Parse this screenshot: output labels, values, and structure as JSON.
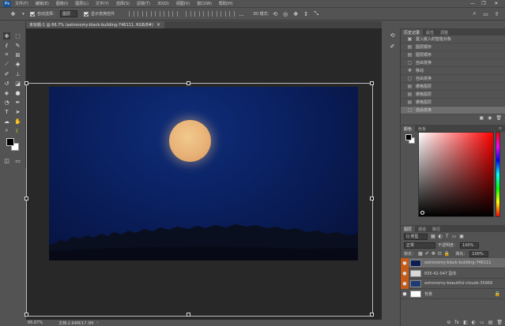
{
  "app": {
    "logo": "Ps"
  },
  "menubar": {
    "items": [
      "文件(F)",
      "编辑(E)",
      "图像(I)",
      "图层(L)",
      "文字(Y)",
      "选择(S)",
      "滤镜(T)",
      "3D(D)",
      "视图(V)",
      "窗口(W)",
      "帮助(H)"
    ]
  },
  "window_controls": {
    "minimize": "—",
    "maximize": "❐",
    "close": "✕"
  },
  "options": {
    "auto_select_label": "自动选择：",
    "auto_select_value": "图层",
    "show_transform_label": "显示变换控件",
    "mode3d_label": "3D 模式："
  },
  "document": {
    "tab_title": "未标题-1 @ 66.7% (astronomy-black-building-746111, RGB/8#)",
    "tab_close": "×"
  },
  "status": {
    "zoom": "66.67%",
    "doc_info": "文档:2.64M/17.3M",
    "arrow": "›"
  },
  "history": {
    "tabs": [
      "历史记录",
      "属性",
      "调整"
    ],
    "items": [
      {
        "label": "置入嵌入的智能对象",
        "icon": "▣"
      },
      {
        "label": "图层顺序",
        "icon": "▤"
      },
      {
        "label": "图层顺序",
        "icon": "▤"
      },
      {
        "label": "自由变换",
        "icon": "▢"
      },
      {
        "label": "移动",
        "icon": "✥"
      },
      {
        "label": "自由变换",
        "icon": "▢"
      },
      {
        "label": "栅格图层",
        "icon": "▤"
      },
      {
        "label": "栅格图层",
        "icon": "▤"
      },
      {
        "label": "栅格图层",
        "icon": "▤"
      },
      {
        "label": "自由变换",
        "icon": "▢"
      }
    ],
    "selected_index": 9
  },
  "color": {
    "tabs": [
      "颜色",
      "色板"
    ],
    "menu": "≡"
  },
  "layers": {
    "tabs": [
      "图层",
      "通道",
      "路径"
    ],
    "filter_label": "Q 类型",
    "blend_mode": "正常",
    "opacity_label": "不透明度：",
    "opacity_value": "100%",
    "lock_label": "锁定：",
    "fill_label": "填充：",
    "fill_value": "100%",
    "items": [
      {
        "name": "astronomy-black-building-746111",
        "eye": "●",
        "thumb": "#0b1d52",
        "highlight": true,
        "selected": true
      },
      {
        "name": "835-42-047 副本",
        "eye": "●",
        "thumb": "#d8d8d8",
        "highlight": true,
        "selected": false
      },
      {
        "name": "astronomy-beautiful-clouds-35969",
        "eye": "●",
        "thumb": "#1d3a73",
        "highlight": true,
        "selected": false
      },
      {
        "name": "背景",
        "eye": "●",
        "thumb": "#ffffff",
        "highlight": false,
        "selected": false
      }
    ],
    "bottom_icons": [
      "⊖",
      "fx",
      "◧",
      "◐",
      "▭",
      "▤",
      "🗑"
    ]
  },
  "colors": {
    "accent_orange": "#c85a18",
    "canvas_bg": "#282828",
    "panel_bg": "#535353"
  }
}
